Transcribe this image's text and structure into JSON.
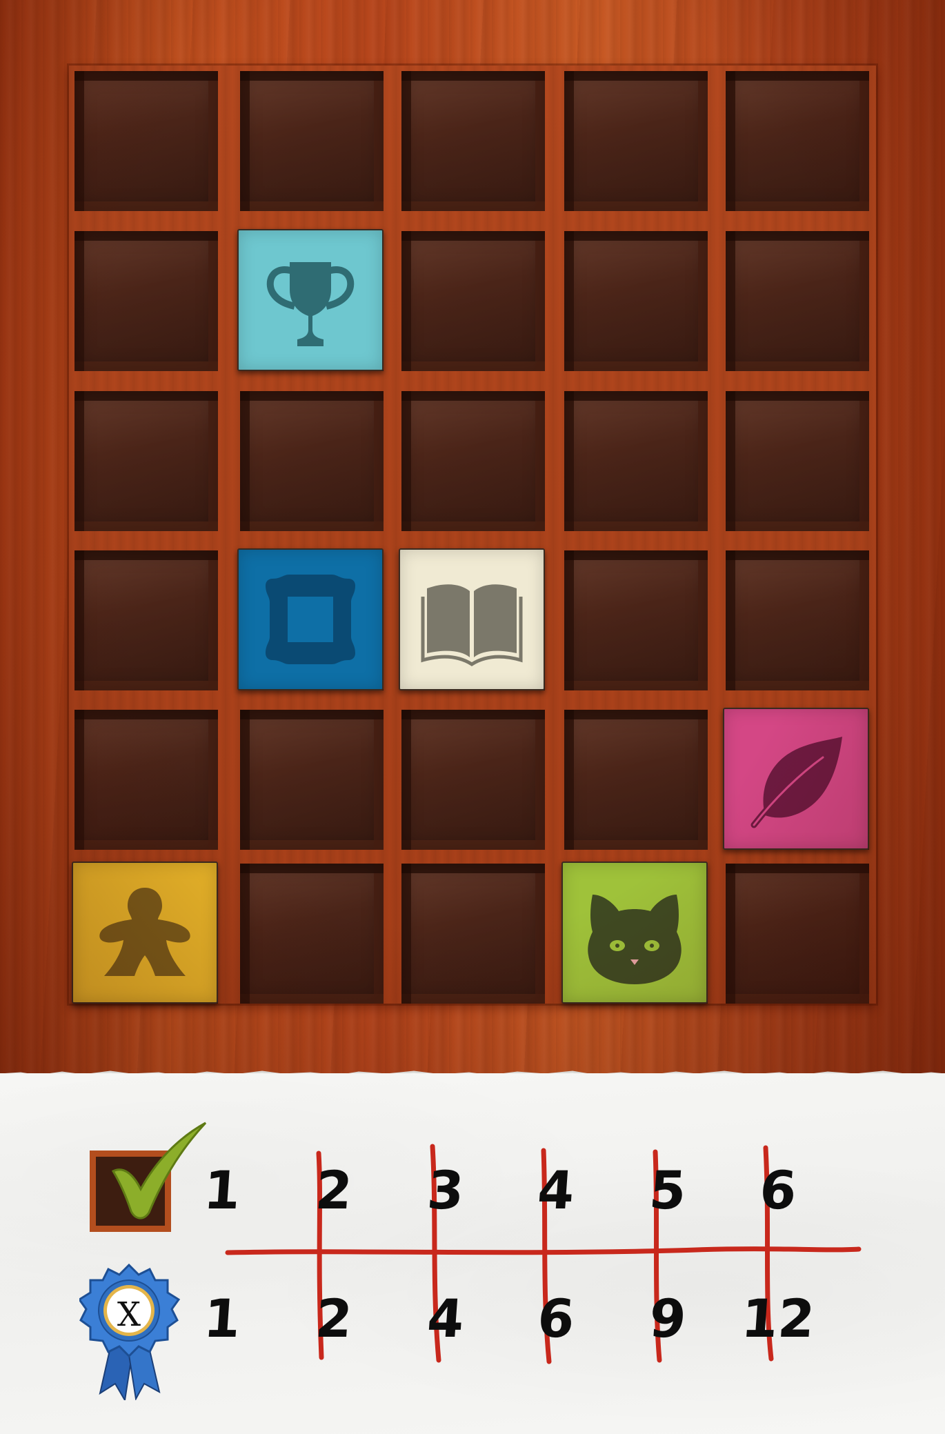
{
  "grid": {
    "rows": 6,
    "cols": 5,
    "tiles": [
      {
        "row": 1,
        "col": 1,
        "icon": "trophy-icon",
        "color": "#6ec7cf",
        "ink": "#2f6c73"
      },
      {
        "row": 3,
        "col": 1,
        "icon": "picture-frame-icon",
        "color": "#0e6fa6",
        "ink": "#0a4a73"
      },
      {
        "row": 3,
        "col": 2,
        "icon": "open-book-icon",
        "color": "#f0ead3",
        "ink": "#7b786a"
      },
      {
        "row": 4,
        "col": 4,
        "icon": "leaf-icon",
        "color": "#d44785",
        "ink": "#6e1a41"
      },
      {
        "row": 5,
        "col": 0,
        "icon": "meeple-icon",
        "color": "#eab72a",
        "ink": "#7a5c1a"
      },
      {
        "row": 5,
        "col": 3,
        "icon": "cat-icon",
        "color": "#9fc23a",
        "ink": "#3f4a22"
      }
    ]
  },
  "scoring": {
    "matches_icon": "checkmark-icon",
    "points_icon": "ribbon-icon",
    "points_label": "X",
    "matches": [
      "1",
      "2",
      "3",
      "4",
      "5",
      "6"
    ],
    "points": [
      "1",
      "2",
      "4",
      "6",
      "9",
      "12"
    ]
  },
  "colors": {
    "wood": "#b8461c",
    "compartment": "#4a2418",
    "paper": "#f3f3f1",
    "pencil_red": "#c8281c",
    "check_green": "#8cae2a",
    "ribbon_blue": "#2f6fc0"
  }
}
